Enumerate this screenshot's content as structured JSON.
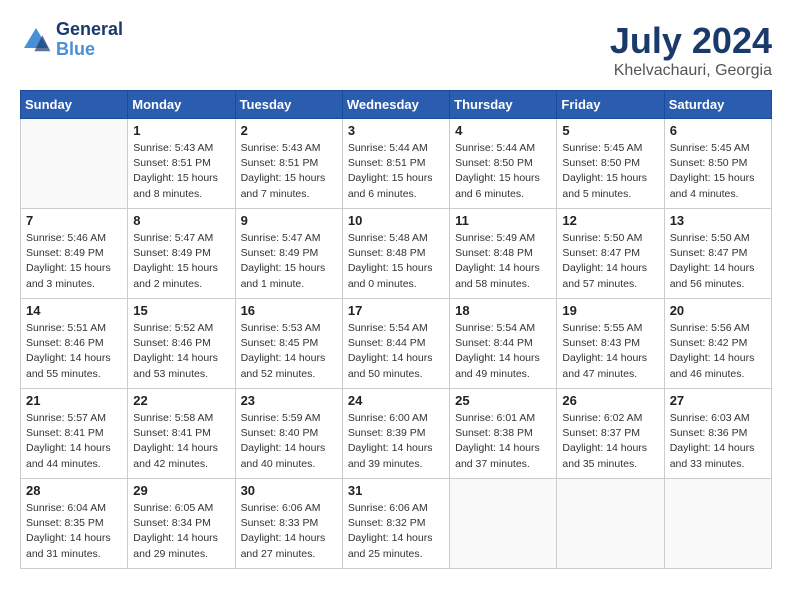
{
  "header": {
    "logo_line1": "General",
    "logo_line2": "Blue",
    "month": "July 2024",
    "location": "Khelvachauri, Georgia"
  },
  "weekdays": [
    "Sunday",
    "Monday",
    "Tuesday",
    "Wednesday",
    "Thursday",
    "Friday",
    "Saturday"
  ],
  "weeks": [
    [
      {
        "day": "",
        "info": ""
      },
      {
        "day": "1",
        "info": "Sunrise: 5:43 AM\nSunset: 8:51 PM\nDaylight: 15 hours\nand 8 minutes."
      },
      {
        "day": "2",
        "info": "Sunrise: 5:43 AM\nSunset: 8:51 PM\nDaylight: 15 hours\nand 7 minutes."
      },
      {
        "day": "3",
        "info": "Sunrise: 5:44 AM\nSunset: 8:51 PM\nDaylight: 15 hours\nand 6 minutes."
      },
      {
        "day": "4",
        "info": "Sunrise: 5:44 AM\nSunset: 8:50 PM\nDaylight: 15 hours\nand 6 minutes."
      },
      {
        "day": "5",
        "info": "Sunrise: 5:45 AM\nSunset: 8:50 PM\nDaylight: 15 hours\nand 5 minutes."
      },
      {
        "day": "6",
        "info": "Sunrise: 5:45 AM\nSunset: 8:50 PM\nDaylight: 15 hours\nand 4 minutes."
      }
    ],
    [
      {
        "day": "7",
        "info": "Sunrise: 5:46 AM\nSunset: 8:49 PM\nDaylight: 15 hours\nand 3 minutes."
      },
      {
        "day": "8",
        "info": "Sunrise: 5:47 AM\nSunset: 8:49 PM\nDaylight: 15 hours\nand 2 minutes."
      },
      {
        "day": "9",
        "info": "Sunrise: 5:47 AM\nSunset: 8:49 PM\nDaylight: 15 hours\nand 1 minute."
      },
      {
        "day": "10",
        "info": "Sunrise: 5:48 AM\nSunset: 8:48 PM\nDaylight: 15 hours\nand 0 minutes."
      },
      {
        "day": "11",
        "info": "Sunrise: 5:49 AM\nSunset: 8:48 PM\nDaylight: 14 hours\nand 58 minutes."
      },
      {
        "day": "12",
        "info": "Sunrise: 5:50 AM\nSunset: 8:47 PM\nDaylight: 14 hours\nand 57 minutes."
      },
      {
        "day": "13",
        "info": "Sunrise: 5:50 AM\nSunset: 8:47 PM\nDaylight: 14 hours\nand 56 minutes."
      }
    ],
    [
      {
        "day": "14",
        "info": "Sunrise: 5:51 AM\nSunset: 8:46 PM\nDaylight: 14 hours\nand 55 minutes."
      },
      {
        "day": "15",
        "info": "Sunrise: 5:52 AM\nSunset: 8:46 PM\nDaylight: 14 hours\nand 53 minutes."
      },
      {
        "day": "16",
        "info": "Sunrise: 5:53 AM\nSunset: 8:45 PM\nDaylight: 14 hours\nand 52 minutes."
      },
      {
        "day": "17",
        "info": "Sunrise: 5:54 AM\nSunset: 8:44 PM\nDaylight: 14 hours\nand 50 minutes."
      },
      {
        "day": "18",
        "info": "Sunrise: 5:54 AM\nSunset: 8:44 PM\nDaylight: 14 hours\nand 49 minutes."
      },
      {
        "day": "19",
        "info": "Sunrise: 5:55 AM\nSunset: 8:43 PM\nDaylight: 14 hours\nand 47 minutes."
      },
      {
        "day": "20",
        "info": "Sunrise: 5:56 AM\nSunset: 8:42 PM\nDaylight: 14 hours\nand 46 minutes."
      }
    ],
    [
      {
        "day": "21",
        "info": "Sunrise: 5:57 AM\nSunset: 8:41 PM\nDaylight: 14 hours\nand 44 minutes."
      },
      {
        "day": "22",
        "info": "Sunrise: 5:58 AM\nSunset: 8:41 PM\nDaylight: 14 hours\nand 42 minutes."
      },
      {
        "day": "23",
        "info": "Sunrise: 5:59 AM\nSunset: 8:40 PM\nDaylight: 14 hours\nand 40 minutes."
      },
      {
        "day": "24",
        "info": "Sunrise: 6:00 AM\nSunset: 8:39 PM\nDaylight: 14 hours\nand 39 minutes."
      },
      {
        "day": "25",
        "info": "Sunrise: 6:01 AM\nSunset: 8:38 PM\nDaylight: 14 hours\nand 37 minutes."
      },
      {
        "day": "26",
        "info": "Sunrise: 6:02 AM\nSunset: 8:37 PM\nDaylight: 14 hours\nand 35 minutes."
      },
      {
        "day": "27",
        "info": "Sunrise: 6:03 AM\nSunset: 8:36 PM\nDaylight: 14 hours\nand 33 minutes."
      }
    ],
    [
      {
        "day": "28",
        "info": "Sunrise: 6:04 AM\nSunset: 8:35 PM\nDaylight: 14 hours\nand 31 minutes."
      },
      {
        "day": "29",
        "info": "Sunrise: 6:05 AM\nSunset: 8:34 PM\nDaylight: 14 hours\nand 29 minutes."
      },
      {
        "day": "30",
        "info": "Sunrise: 6:06 AM\nSunset: 8:33 PM\nDaylight: 14 hours\nand 27 minutes."
      },
      {
        "day": "31",
        "info": "Sunrise: 6:06 AM\nSunset: 8:32 PM\nDaylight: 14 hours\nand 25 minutes."
      },
      {
        "day": "",
        "info": ""
      },
      {
        "day": "",
        "info": ""
      },
      {
        "day": "",
        "info": ""
      }
    ]
  ]
}
